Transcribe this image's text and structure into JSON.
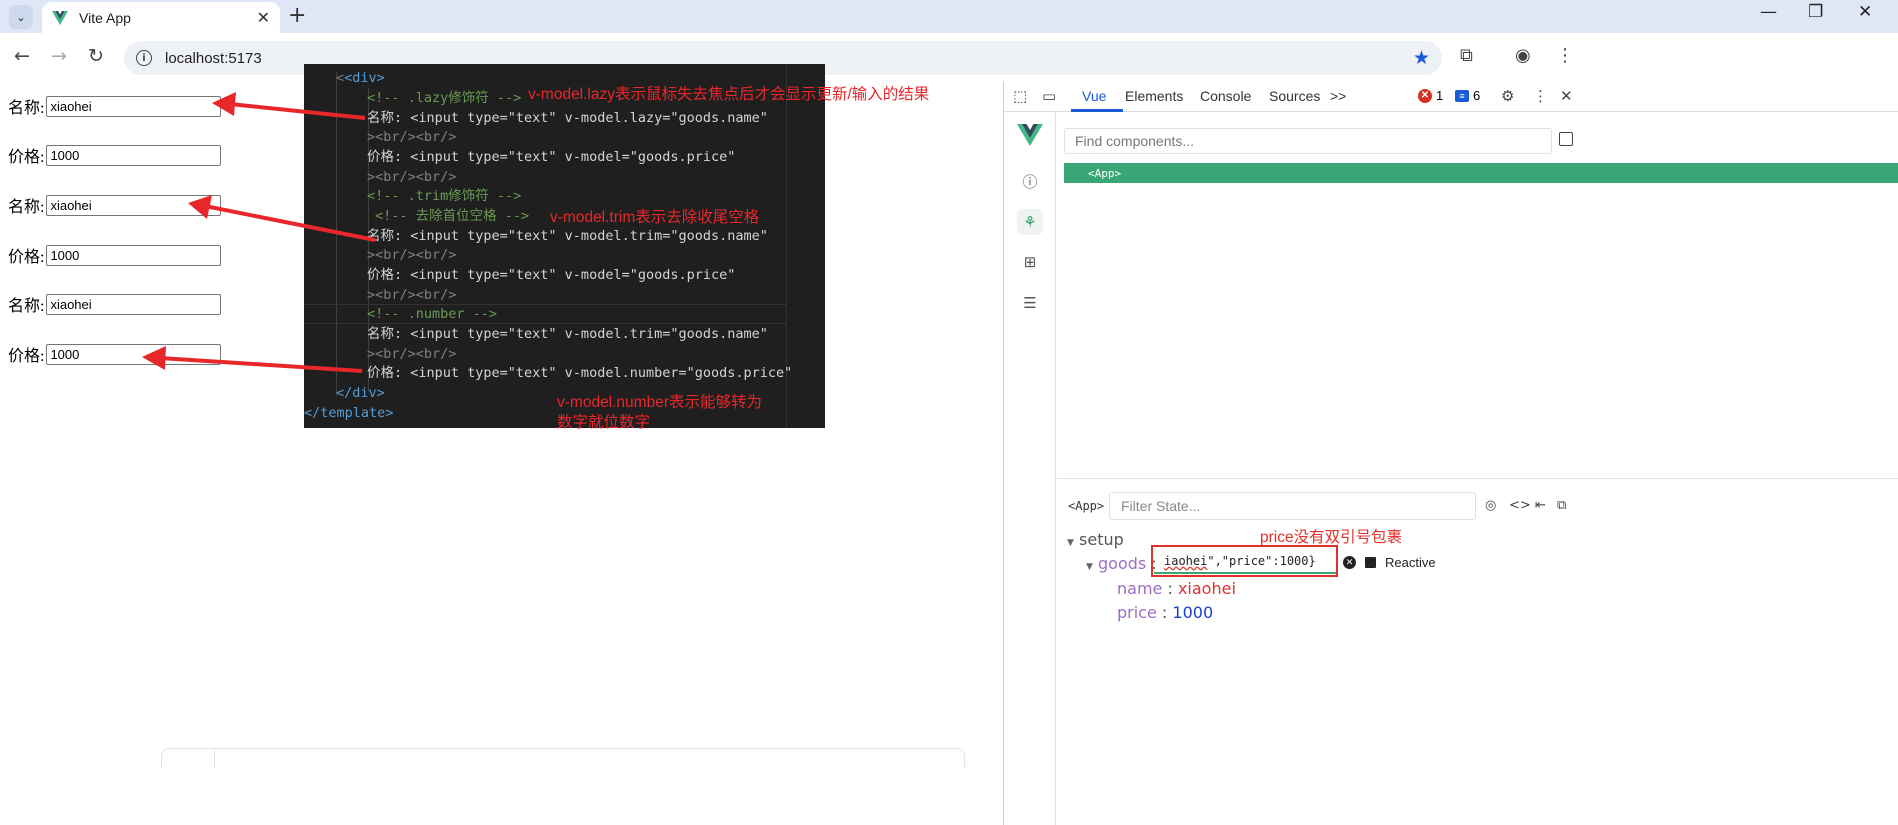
{
  "browser": {
    "tab_title": "Vite App",
    "url": "localhost:5173",
    "new_tab_symbol": "+",
    "close_symbol": "✕"
  },
  "form": {
    "rows": [
      {
        "label": "名称:",
        "value": "xiaohei"
      },
      {
        "label": "价格:",
        "value": "1000"
      },
      {
        "label": "名称:",
        "value": "xiaohei"
      },
      {
        "label": "价格:",
        "value": "1000"
      },
      {
        "label": "名称:",
        "value": "xiaohei"
      },
      {
        "label": "价格:",
        "value": "1000"
      }
    ]
  },
  "code": {
    "lines": [
      "<div>",
      "<!-- .lazy修饰符 -->",
      "名称: <input type=\"text\" v-model.lazy=\"goods.name\"",
      "><br/><br/>",
      "价格: <input type=\"text\" v-model=\"goods.price\"",
      "><br/><br/>",
      "<!-- .trim修饰符 -->",
      "<!-- 去除首位空格 -->",
      "名称: <input type=\"text\" v-model.trim=\"goods.name\"",
      "><br/><br/>",
      "价格: <input type=\"text\" v-model=\"goods.price\"",
      "><br/><br/>",
      "<!-- .number -->",
      "名称: <input type=\"text\" v-model.trim=\"goods.name\"",
      "><br/><br/>",
      "价格: <input type=\"text\" v-model.number=\"goods.price\"",
      "</div>",
      "</template>"
    ]
  },
  "annotations": {
    "lazy": "v-model.lazy表示鼠标失去焦点后才会显示更新/输入的结果",
    "trim": "v-model.trim表示去除收尾空格",
    "number_line1": "v-model.number表示能够转为",
    "number_line2": "数字就位数字",
    "price_note": "price没有双引号包裹"
  },
  "devtools": {
    "tabs": [
      "Vue",
      "Elements",
      "Console",
      "Sources"
    ],
    "more_tabs": ">>",
    "active_tab": "Vue",
    "errors": "1",
    "messages": "6",
    "find_placeholder": "Find components...",
    "root_component": "<App>",
    "state_component": "<App>",
    "filter_placeholder": "Filter State...",
    "setup_label": "setup",
    "goods_key": "goods",
    "colon": ":",
    "edit_value_prefix": "iaohei",
    "edit_value_rest": "\",\"price\":1000}",
    "reactive_label": "Reactive",
    "fields": [
      {
        "key": "name",
        "value": "xiaohei",
        "type": "string"
      },
      {
        "key": "price",
        "value": "1000",
        "type": "number"
      }
    ]
  },
  "colors": {
    "vue_green": "#3aa675",
    "annotation_red": "#e8272b",
    "chrome_blue": "#1a5cd8"
  }
}
